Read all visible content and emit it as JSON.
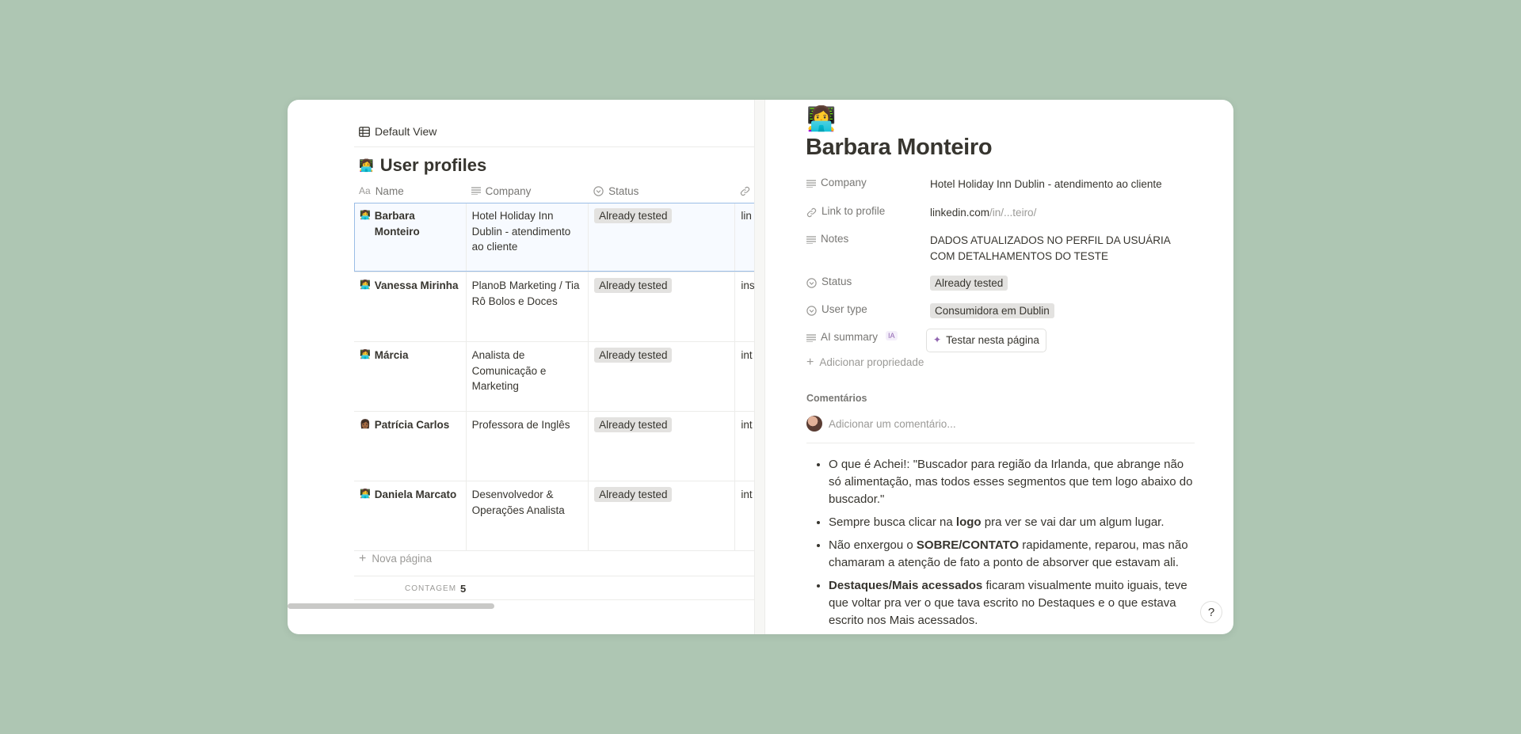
{
  "view": {
    "label": "Default View"
  },
  "database": {
    "emoji": "👩‍💻",
    "title": "User profiles"
  },
  "columns": {
    "name": "Name",
    "company": "Company",
    "status": "Status"
  },
  "rows": [
    {
      "emoji": "👩‍💻",
      "name": "Barbara Monteiro",
      "company": "Hotel Holiday Inn Dublin - atendimento ao cliente",
      "status": "Already tested",
      "link": "lin"
    },
    {
      "emoji": "👩‍💻",
      "name": "Vanessa Mirinha",
      "company": "PlanoB Marketing / Tia Rô Bolos e Doces",
      "status": "Already tested",
      "link": "ins"
    },
    {
      "emoji": "👩‍💻",
      "name": "Márcia",
      "company": "Analista de Comunicação e Marketing",
      "status": "Already tested",
      "link": "int"
    },
    {
      "emoji": "👩🏾",
      "name": "Patrícia Carlos",
      "company": "Professora de Inglês",
      "status": "Already tested",
      "link": "int"
    },
    {
      "emoji": "👩‍💻",
      "name": "Daniela Marcato",
      "company": "Desenvolvedor & Operações Analista",
      "status": "Already tested",
      "link": "int"
    }
  ],
  "footer": {
    "new_page": "Nova página",
    "count_label": "CONTAGEM",
    "count_value": "5"
  },
  "page": {
    "emoji": "👩‍💻",
    "title": "Barbara Monteiro",
    "props": {
      "company_label": "Company",
      "company_value": "Hotel Holiday Inn Dublin - atendimento ao cliente",
      "link_label": "Link to profile",
      "link_domain": "linkedin.com",
      "link_path": "/in/...teiro/",
      "notes_label": "Notes",
      "notes_value": "DADOS ATUALIZADOS NO PERFIL DA USUÁRIA COM DETALHAMENTOS DO TESTE",
      "status_label": "Status",
      "status_value": "Already tested",
      "usertype_label": "User type",
      "usertype_value": "Consumidora em Dublin",
      "ai_label": "AI summary",
      "ai_badge": "IA",
      "ai_button": "Testar nesta página",
      "add_prop": "Adicionar propriedade"
    },
    "comments_label": "Comentários",
    "comment_placeholder": "Adicionar um comentário...",
    "bullets": {
      "b1": "O que é Achei!: \"Buscador para região da Irlanda, que abrange não só alimentação, mas todos esses segmentos que tem logo abaixo do buscador.\"",
      "b2_a": "Sempre busca clicar na ",
      "b2_b": "logo",
      "b2_c": " pra ver se vai dar um algum lugar.",
      "b3_a": "Não enxergou o ",
      "b3_b": "SOBRE/CONTATO",
      "b3_c": " rapidamente, reparou, mas não chamaram a atenção de fato a ponto de absorver que estavam ali.",
      "b4_a": "Destaques/Mais acessados",
      "b4_b": " ficaram visualmente muito iguais, teve que voltar pra ver o que tava escrito no Destaques e o que estava escrito nos Mais acessados."
    }
  }
}
